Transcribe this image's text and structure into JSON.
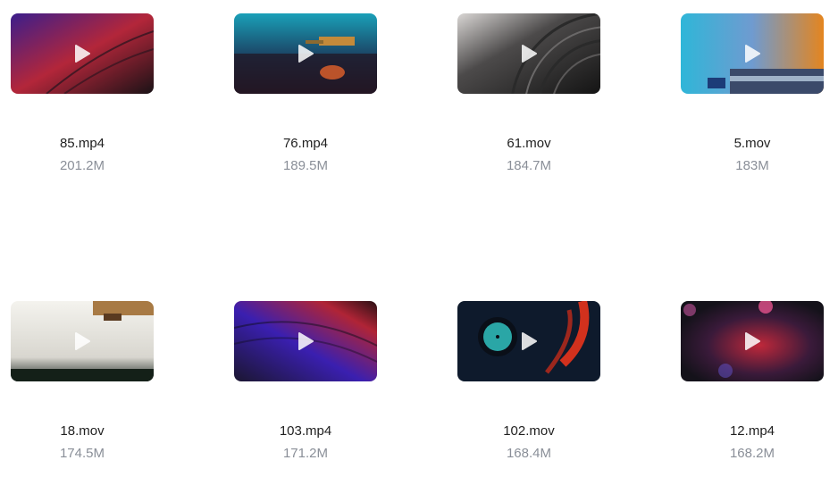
{
  "videos": [
    {
      "name": "85.mp4",
      "size": "201.2M",
      "thumb": "purple-red-vinyl"
    },
    {
      "name": "76.mp4",
      "size": "189.5M",
      "thumb": "teal-turntable-tonearm"
    },
    {
      "name": "61.mov",
      "size": "184.7M",
      "thumb": "black-vinyl-grooves"
    },
    {
      "name": "5.mov",
      "size": "183M",
      "thumb": "blue-orange-turntable"
    },
    {
      "name": "18.mov",
      "size": "174.5M",
      "thumb": "white-turntable-cartridge"
    },
    {
      "name": "103.mp4",
      "size": "171.2M",
      "thumb": "purple-red-vinyl"
    },
    {
      "name": "102.mov",
      "size": "168.4M",
      "thumb": "teal-label-red-tonearm"
    },
    {
      "name": "12.mp4",
      "size": "168.2M",
      "thumb": "dark-red-bokeh"
    }
  ],
  "icons": {
    "play": "play-icon"
  },
  "colors": {
    "name_text": "#1f1f1f",
    "size_text": "#8a8f98",
    "play_icon": "#ffffff"
  }
}
